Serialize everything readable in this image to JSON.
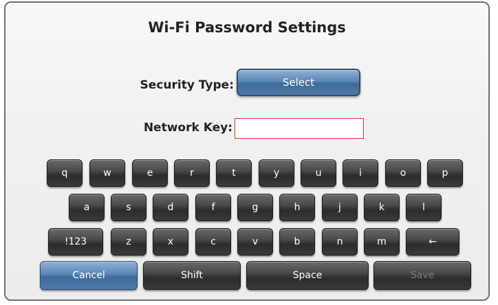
{
  "title": "Wi-Fi Password Settings",
  "security": {
    "label": "Security Type:",
    "button_label": "Select"
  },
  "network_key": {
    "label": "Network Key:",
    "value": ""
  },
  "keyboard": {
    "row1": [
      "q",
      "w",
      "e",
      "r",
      "t",
      "y",
      "u",
      "i",
      "o",
      "p"
    ],
    "row2": [
      "a",
      "s",
      "d",
      "f",
      "g",
      "h",
      "j",
      "k",
      "l"
    ],
    "row3": [
      "!123",
      "z",
      "x",
      "c",
      "v",
      "b",
      "n",
      "m",
      "←"
    ],
    "cancel": "Cancel",
    "shift": "Shift",
    "space": "Space",
    "save": "Save"
  }
}
